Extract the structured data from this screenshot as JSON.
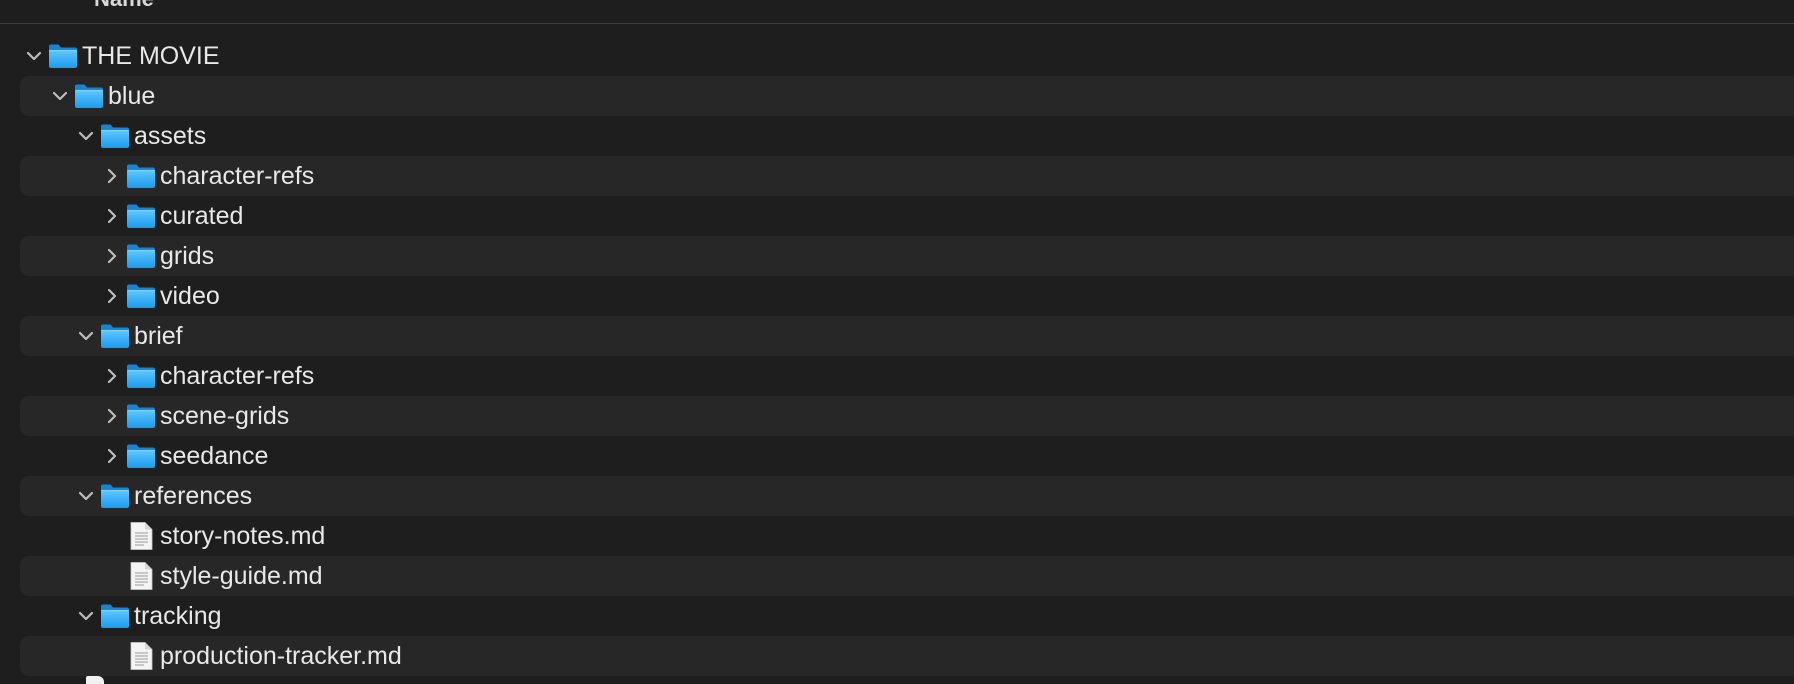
{
  "header": {
    "column_name": "Name"
  },
  "tree": [
    {
      "label": "THE MOVIE",
      "kind": "folder",
      "depth": 0,
      "state": "expanded"
    },
    {
      "label": "blue",
      "kind": "folder",
      "depth": 1,
      "state": "expanded"
    },
    {
      "label": "assets",
      "kind": "folder",
      "depth": 2,
      "state": "expanded"
    },
    {
      "label": "character-refs",
      "kind": "folder",
      "depth": 3,
      "state": "collapsed"
    },
    {
      "label": "curated",
      "kind": "folder",
      "depth": 3,
      "state": "collapsed"
    },
    {
      "label": "grids",
      "kind": "folder",
      "depth": 3,
      "state": "collapsed"
    },
    {
      "label": "video",
      "kind": "folder",
      "depth": 3,
      "state": "collapsed"
    },
    {
      "label": "brief",
      "kind": "folder",
      "depth": 2,
      "state": "expanded"
    },
    {
      "label": "character-refs",
      "kind": "folder",
      "depth": 3,
      "state": "collapsed"
    },
    {
      "label": "scene-grids",
      "kind": "folder",
      "depth": 3,
      "state": "collapsed"
    },
    {
      "label": "seedance",
      "kind": "folder",
      "depth": 3,
      "state": "collapsed"
    },
    {
      "label": "references",
      "kind": "folder",
      "depth": 2,
      "state": "expanded"
    },
    {
      "label": "story-notes.md",
      "kind": "file",
      "depth": 3,
      "state": "none"
    },
    {
      "label": "style-guide.md",
      "kind": "file",
      "depth": 3,
      "state": "none"
    },
    {
      "label": "tracking",
      "kind": "folder",
      "depth": 2,
      "state": "expanded"
    },
    {
      "label": "production-tracker.md",
      "kind": "file",
      "depth": 3,
      "state": "none"
    }
  ],
  "icons": {
    "folder": "folder-icon",
    "file": "document-icon",
    "expanded": "chevron-down-icon",
    "collapsed": "chevron-right-icon"
  },
  "colors": {
    "background": "#1e1e1e",
    "row_alt": "#272727",
    "folder_top": "#5ec8ff",
    "folder_bottom": "#1b9bee",
    "text": "#e8e8e8",
    "chevron": "#bdbdbd",
    "divider": "#3c3c3c"
  }
}
